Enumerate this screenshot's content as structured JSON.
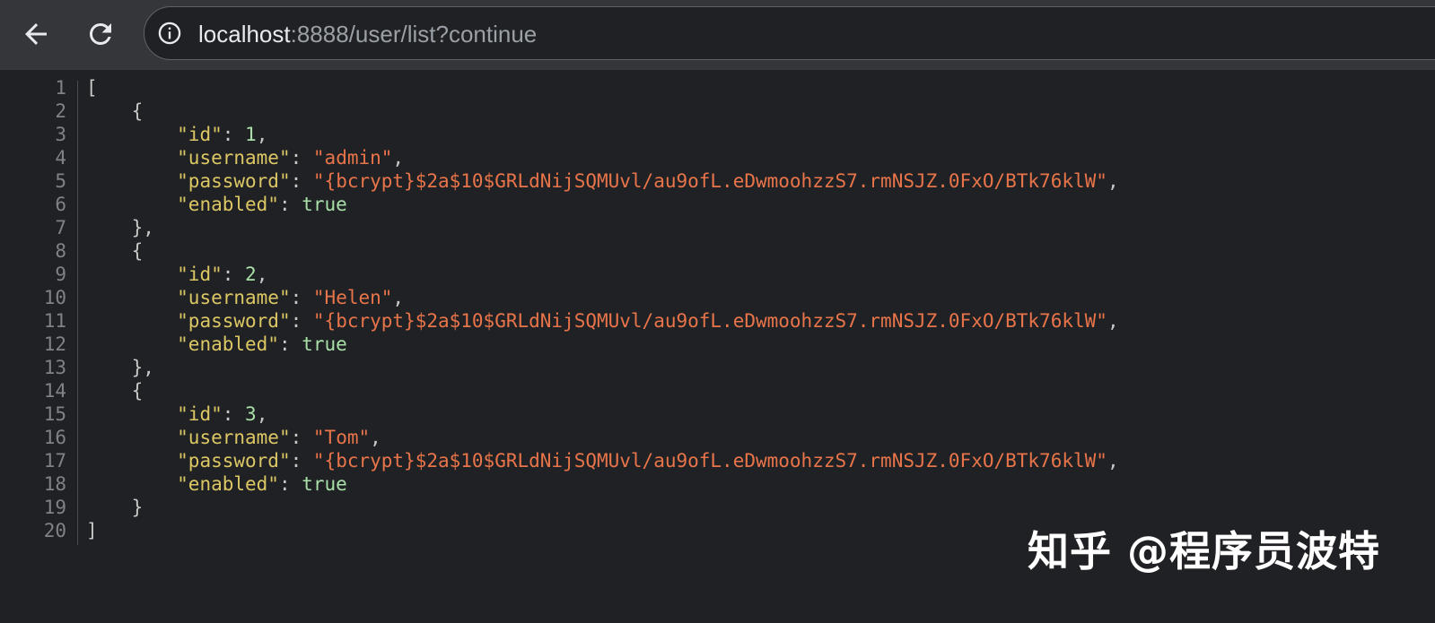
{
  "browser": {
    "back_icon": "arrow-left-icon",
    "reload_icon": "reload-icon",
    "info_icon": "info-circle-icon",
    "url_host": "localhost",
    "url_rest": ":8888/user/list?continue"
  },
  "viewer": {
    "line_numbers": [
      "1",
      "2",
      "3",
      "4",
      "5",
      "6",
      "7",
      "8",
      "9",
      "10",
      "11",
      "12",
      "13",
      "14",
      "15",
      "16",
      "17",
      "18",
      "19",
      "20"
    ],
    "users": [
      {
        "id": "1",
        "username": "admin",
        "password": "{bcrypt}$2a$10$GRLdNijSQMUvl/au9ofL.eDwmoohzzS7.rmNSJZ.0FxO/BTk76klW",
        "enabled": "true"
      },
      {
        "id": "2",
        "username": "Helen",
        "password": "{bcrypt}$2a$10$GRLdNijSQMUvl/au9ofL.eDwmoohzzS7.rmNSJZ.0FxO/BTk76klW",
        "enabled": "true"
      },
      {
        "id": "3",
        "username": "Tom",
        "password": "{bcrypt}$2a$10$GRLdNijSQMUvl/au9ofL.eDwmoohzzS7.rmNSJZ.0FxO/BTk76klW",
        "enabled": "true"
      }
    ],
    "keys": {
      "id": "\"id\"",
      "username": "\"username\"",
      "password": "\"password\"",
      "enabled": "\"enabled\""
    }
  },
  "watermark": "知乎 @程序员波特",
  "colors": {
    "key": "#dcc765",
    "string": "#e8744a",
    "number": "#a8e0a8",
    "background": "#202124"
  }
}
